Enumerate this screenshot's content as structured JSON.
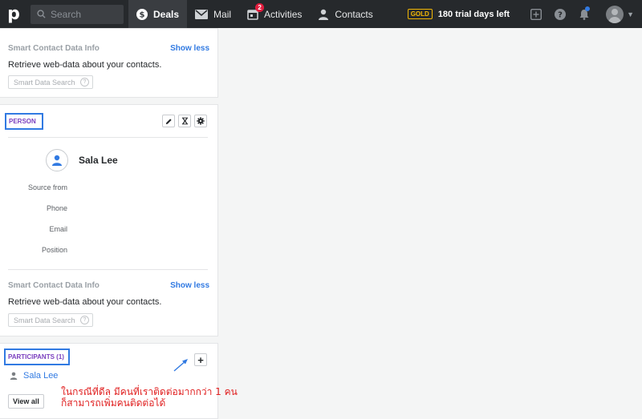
{
  "topbar": {
    "logo": "p",
    "search_placeholder": "Search",
    "nav": [
      {
        "label": "Deals",
        "icon": "dollar-icon",
        "active": true
      },
      {
        "label": "Mail",
        "icon": "mail-icon"
      },
      {
        "label": "Activities",
        "icon": "calendar-icon",
        "badge": "2"
      },
      {
        "label": "Contacts",
        "icon": "person-icon"
      }
    ],
    "plan_badge": "GOLD",
    "trial_text": "180 trial days left",
    "icons": [
      "add-icon",
      "help-icon",
      "bell-icon",
      "avatar"
    ]
  },
  "smart_top": {
    "title": "Smart Contact Data Info",
    "toggle": "Show less",
    "description": "Retrieve web-data about your contacts.",
    "search_placeholder": "Smart Data Search",
    "help": "?"
  },
  "person": {
    "section_label": "PERSON",
    "name": "Sala Lee",
    "fields": [
      "Source from",
      "Phone",
      "Email",
      "Position"
    ],
    "smart": {
      "title": "Smart Contact Data Info",
      "toggle": "Show less",
      "description": "Retrieve web-data about your contacts.",
      "search_placeholder": "Smart Data Search",
      "help": "?"
    }
  },
  "participants": {
    "section_label": "PARTICIPANTS (1)",
    "add_label": "+",
    "items": [
      {
        "name": "Sala Lee"
      }
    ],
    "view_all": "View all"
  },
  "annotation": {
    "line1": "ในกรณีที่ดีล มีคนที่เราติดต่อมากกว่า 1 คน",
    "line2": "ก็สามารถเพิ่มคนติดต่อได้"
  },
  "colors": {
    "topbar": "#26292c",
    "accent": "#317ae2",
    "highlight_box": "#317ae2",
    "annotation": "#e01f1f",
    "gold": "#f2b705"
  }
}
